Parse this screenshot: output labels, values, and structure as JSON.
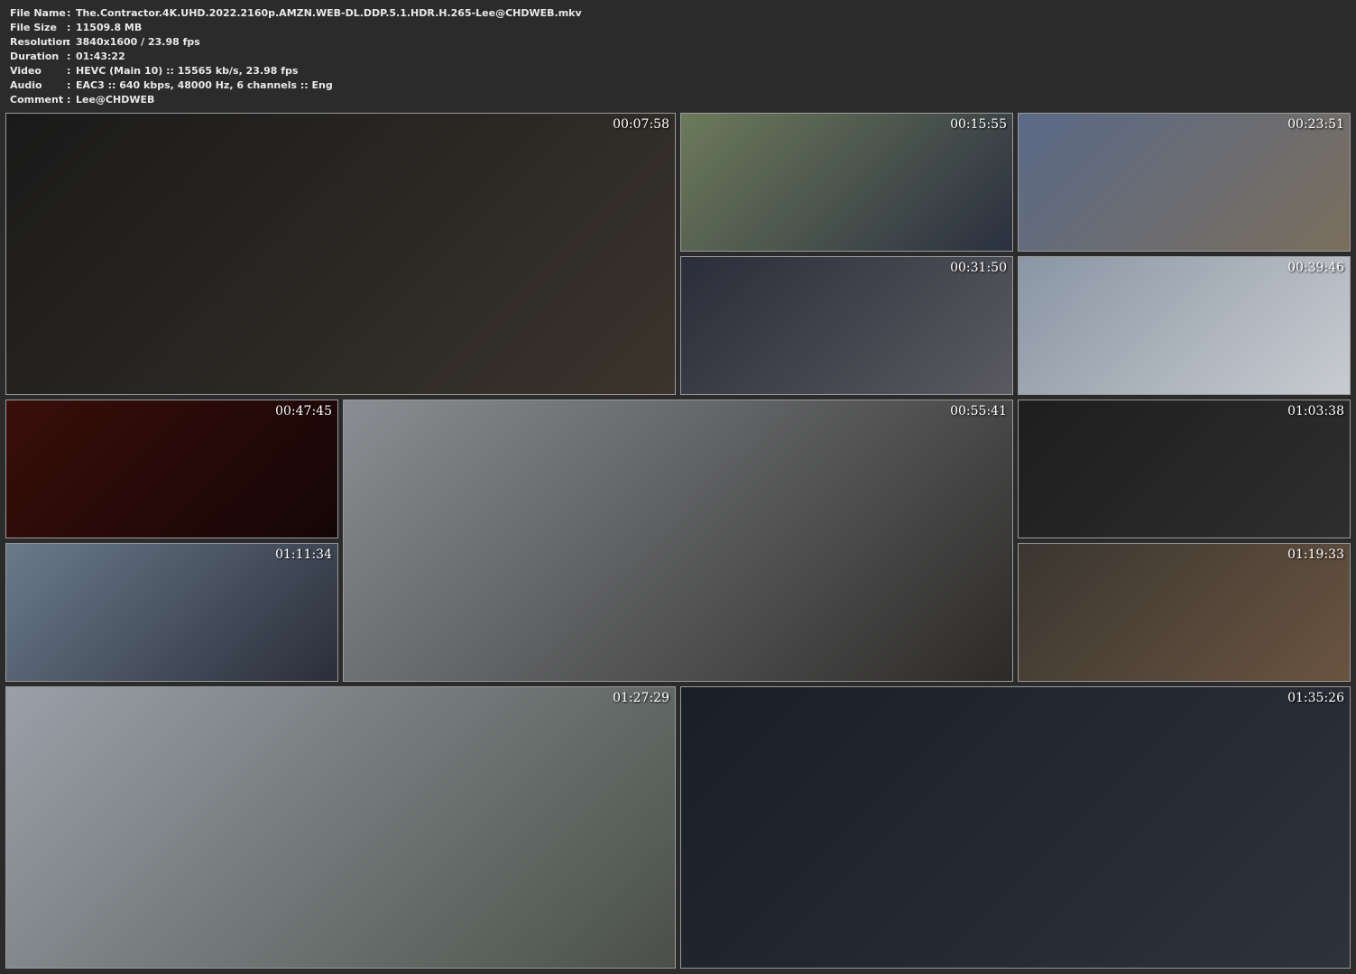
{
  "info": [
    {
      "label": "File Name",
      "value": "The.Contractor.4K.UHD.2022.2160p.AMZN.WEB-DL.DDP.5.1.HDR.H.265-Lee@CHDWEB.mkv"
    },
    {
      "label": "File Size",
      "value": "11509.8 MB"
    },
    {
      "label": "Resolution",
      "value": "3840x1600 / 23.98 fps"
    },
    {
      "label": "Duration",
      "value": "01:43:22"
    },
    {
      "label": "Video",
      "value": "HEVC (Main 10) :: 15565 kb/s, 23.98 fps"
    },
    {
      "label": "Audio",
      "value": "EAC3 :: 640 kbps, 48000 Hz, 6 channels :: Eng"
    },
    {
      "label": "Comment",
      "value": "Lee@CHDWEB"
    }
  ],
  "separator": ":",
  "thumbnails": [
    {
      "time": "00:07:58",
      "colors": [
        "#1a1a1a",
        "#3a342c"
      ]
    },
    {
      "time": "00:15:55",
      "colors": [
        "#6c7a5a",
        "#2a3040"
      ]
    },
    {
      "time": "00:23:51",
      "colors": [
        "#5a6a88",
        "#7a6e5c"
      ]
    },
    {
      "time": "00:31:50",
      "colors": [
        "#2a2e3a",
        "#5a5a60"
      ]
    },
    {
      "time": "00:39:46",
      "colors": [
        "#8a96a4",
        "#c8ccd0"
      ]
    },
    {
      "time": "00:47:45",
      "colors": [
        "#3a0e0a",
        "#140606"
      ]
    },
    {
      "time": "00:55:41",
      "colors": [
        "#8a8e92",
        "#2c2a28"
      ]
    },
    {
      "time": "01:03:38",
      "colors": [
        "#1e1e1e",
        "#2e2e2e"
      ]
    },
    {
      "time": "01:11:34",
      "colors": [
        "#6a7a8a",
        "#2a2e3a"
      ]
    },
    {
      "time": "01:19:33",
      "colors": [
        "#3a3630",
        "#6a5440"
      ]
    },
    {
      "time": "01:27:29",
      "colors": [
        "#9aa0a8",
        "#4a5048"
      ]
    },
    {
      "time": "01:35:26",
      "colors": [
        "#1a1e26",
        "#2e323a"
      ]
    }
  ]
}
